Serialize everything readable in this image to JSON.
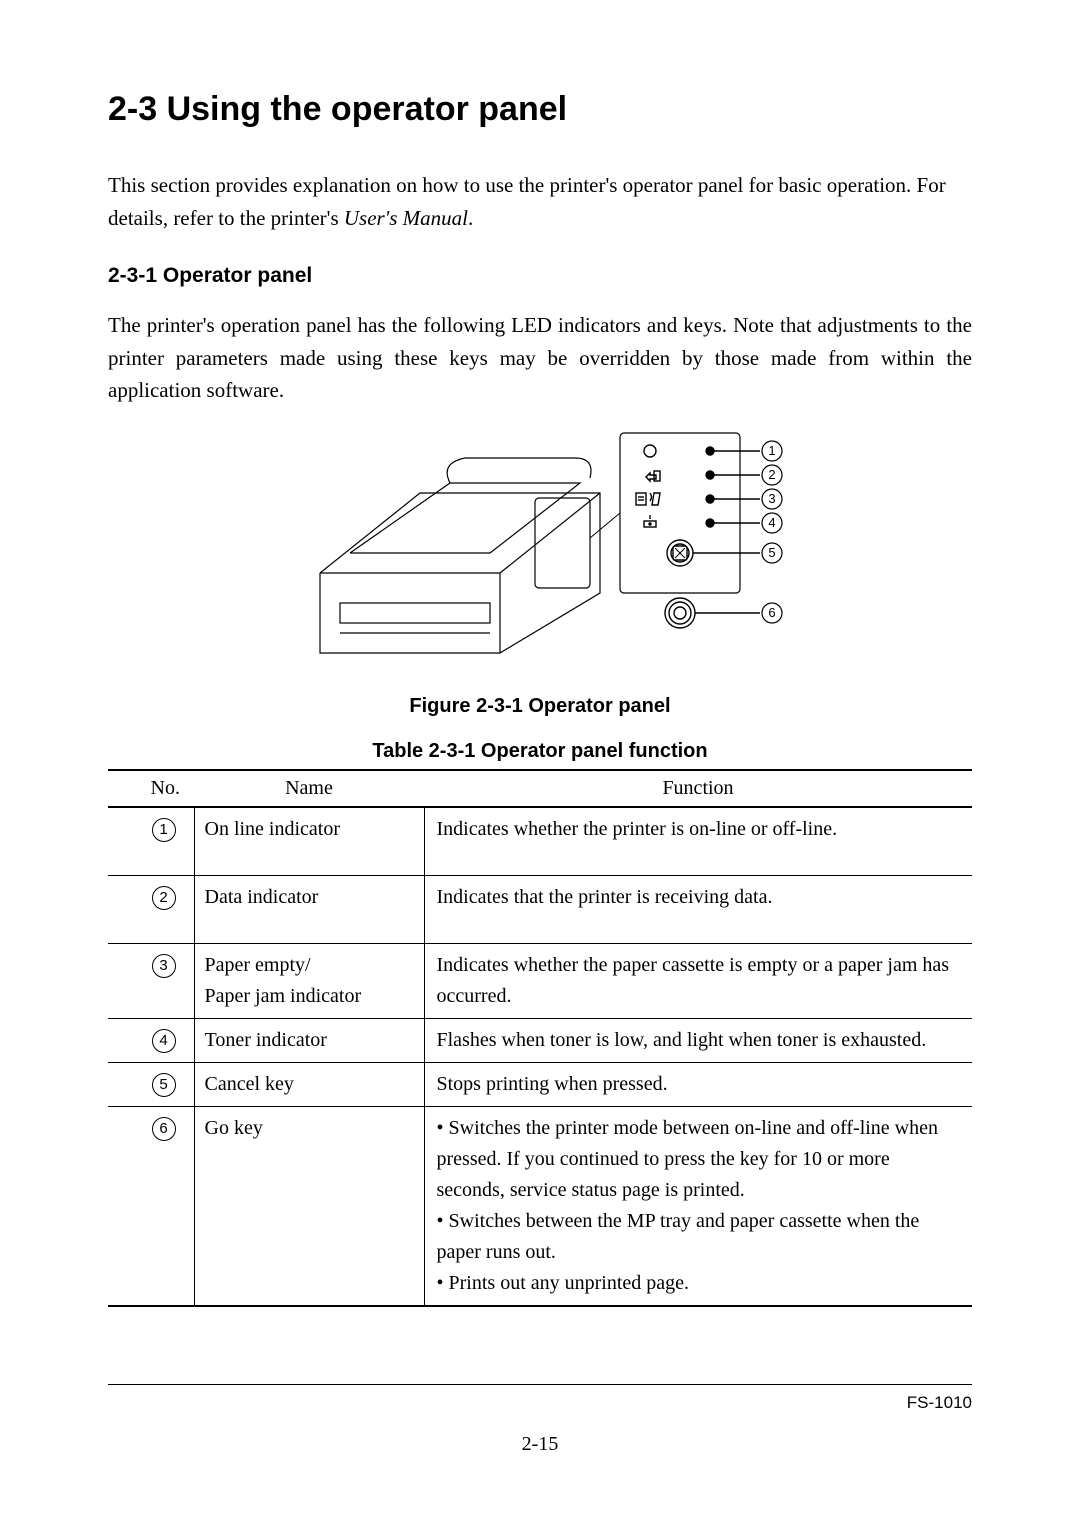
{
  "heading": "2-3 Using the operator panel",
  "intro_html": "This section provides explanation on how to use the printer's operator panel for basic operation. For details, refer to the printer's ",
  "intro_em": "User's Manual",
  "intro_tail": ".",
  "subheading": "2-3-1 Operator panel",
  "subintro": "The printer's operation panel has the following LED indicators and keys. Note that adjustments to the printer parameters made using these keys may be overridden by those made from within the application software.",
  "figure_caption": "Figure 2-3-1 Operator panel",
  "table_caption": "Table 2-3-1 Operator panel function",
  "table": {
    "headers": {
      "no": "No.",
      "name": "Name",
      "fn": "Function"
    },
    "rows": [
      {
        "num": "1",
        "name": "On line indicator",
        "fn": "Indicates whether the printer is on-line or off-line."
      },
      {
        "num": "2",
        "name": "Data indicator",
        "fn": "Indicates that the printer is receiving data."
      },
      {
        "num": "3",
        "name": "Paper empty/\nPaper jam indicator",
        "fn": "Indicates whether the paper cassette is empty or a paper jam has occurred."
      },
      {
        "num": "4",
        "name": "Toner indicator",
        "fn": "Flashes when toner is low, and light when toner is exhausted."
      },
      {
        "num": "5",
        "name": "Cancel key",
        "fn": "Stops printing when pressed."
      },
      {
        "num": "6",
        "name": "Go key",
        "fn_bullets": [
          "Switches the printer mode between on-line and off-line when pressed. If you continued to press the key for 10 or more seconds, service status page is printed.",
          "Switches between the MP tray and paper cassette when the paper runs out.",
          "Prints out any unprinted page."
        ]
      }
    ]
  },
  "doc_id": "FS-1010",
  "page_num": "2-15",
  "callouts": [
    "1",
    "2",
    "3",
    "4",
    "5",
    "6"
  ]
}
